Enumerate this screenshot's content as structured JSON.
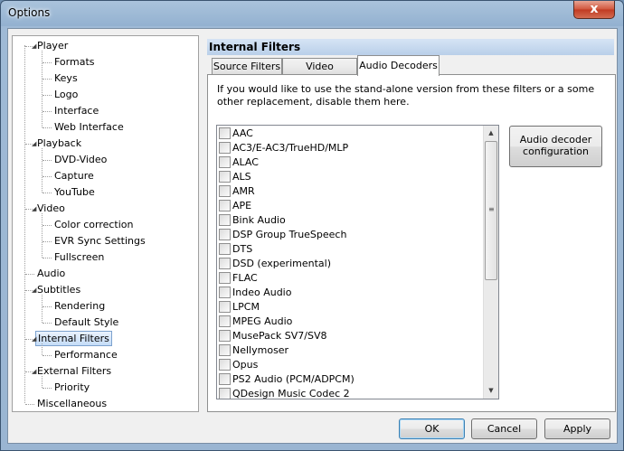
{
  "window": {
    "title": "Options",
    "close_label": "x"
  },
  "tree": {
    "items": [
      {
        "label": "Player",
        "level": 0,
        "expanded": true
      },
      {
        "label": "Formats",
        "level": 1
      },
      {
        "label": "Keys",
        "level": 1
      },
      {
        "label": "Logo",
        "level": 1
      },
      {
        "label": "Interface",
        "level": 1
      },
      {
        "label": "Web Interface",
        "level": 1
      },
      {
        "label": "Playback",
        "level": 0,
        "expanded": true
      },
      {
        "label": "DVD-Video",
        "level": 1
      },
      {
        "label": "Capture",
        "level": 1
      },
      {
        "label": "YouTube",
        "level": 1
      },
      {
        "label": "Video",
        "level": 0,
        "expanded": true
      },
      {
        "label": "Color correction",
        "level": 1
      },
      {
        "label": "EVR Sync Settings",
        "level": 1
      },
      {
        "label": "Fullscreen",
        "level": 1
      },
      {
        "label": "Audio",
        "level": 0
      },
      {
        "label": "Subtitles",
        "level": 0,
        "expanded": true
      },
      {
        "label": "Rendering",
        "level": 1
      },
      {
        "label": "Default Style",
        "level": 1
      },
      {
        "label": "Internal Filters",
        "level": 0,
        "expanded": true,
        "selected": true
      },
      {
        "label": "Performance",
        "level": 1
      },
      {
        "label": "External Filters",
        "level": 0,
        "expanded": true
      },
      {
        "label": "Priority",
        "level": 1
      },
      {
        "label": "Miscellaneous",
        "level": 0
      }
    ]
  },
  "panel": {
    "title": "Internal Filters",
    "tabs": [
      "Source Filters",
      "Video Decoders",
      "Audio Decoders"
    ],
    "active_tab": 2,
    "description": "If you would like to use the stand-alone version from these filters or a some other replacement, disable them here.",
    "decoders": [
      "AAC",
      "AC3/E-AC3/TrueHD/MLP",
      "ALAC",
      "ALS",
      "AMR",
      "APE",
      "Bink Audio",
      "DSP Group TrueSpeech",
      "DTS",
      "DSD (experimental)",
      "FLAC",
      "Indeo Audio",
      "LPCM",
      "MPEG Audio",
      "MusePack SV7/SV8",
      "Nellymoser",
      "Opus",
      "PS2 Audio (PCM/ADPCM)",
      "QDesign Music Codec 2"
    ],
    "config_button": "Audio decoder configuration"
  },
  "buttons": {
    "ok": "OK",
    "cancel": "Cancel",
    "apply": "Apply"
  },
  "icons": {
    "expanded": "triangle-down-icon",
    "scroll_up": "arrow-up-icon",
    "scroll_down": "arrow-down-icon"
  }
}
